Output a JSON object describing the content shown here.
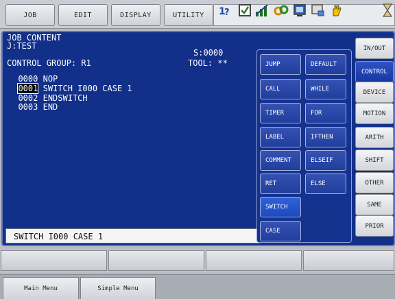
{
  "menu": {
    "job": "JOB",
    "edit": "EDIT",
    "display": "DISPLAY",
    "utility": "UTILITY"
  },
  "toolbar_icons": [
    "job-status-icon",
    "check-box-icon",
    "signal-strength-icon",
    "tool-coordinate-icon",
    "display-icon",
    "monitor-check-icon",
    "hand-teach-icon",
    "hourglass-icon"
  ],
  "header": {
    "title": "JOB CONTENT",
    "job": "J:TEST",
    "step": "S:0000",
    "group": "CONTROL GROUP: R1",
    "tool": "TOOL: **"
  },
  "job_lines": [
    {
      "num": "0000",
      "text": "NOP"
    },
    {
      "num": "0001",
      "text": "SWITCH I000 CASE 1"
    },
    {
      "num": "0002",
      "text": "ENDSWITCH"
    },
    {
      "num": "0003",
      "text": "END"
    }
  ],
  "input_line": "SWITCH I000 CASE 1",
  "instructions": [
    "JUMP",
    "DEFAULT",
    "CALL",
    "WHILE",
    "TIMER",
    "FOR",
    "LABEL",
    "IFTHEN",
    "COMMENT",
    "ELSEIF",
    "RET",
    "ELSE",
    "SWITCH",
    "CASE"
  ],
  "categories": [
    "IN/OUT",
    "CONTROL",
    "DEVICE",
    "MOTION",
    "ARITH",
    "SHIFT",
    "OTHER",
    "SAME",
    "PRIOR"
  ],
  "selected_category": "CONTROL",
  "bottom_tabs": {
    "main_menu": "Main Menu",
    "simple_menu": "Simple Menu"
  },
  "colors": {
    "panel": "#12308a",
    "selected": "#2f52c4",
    "cursor": "#000000"
  }
}
